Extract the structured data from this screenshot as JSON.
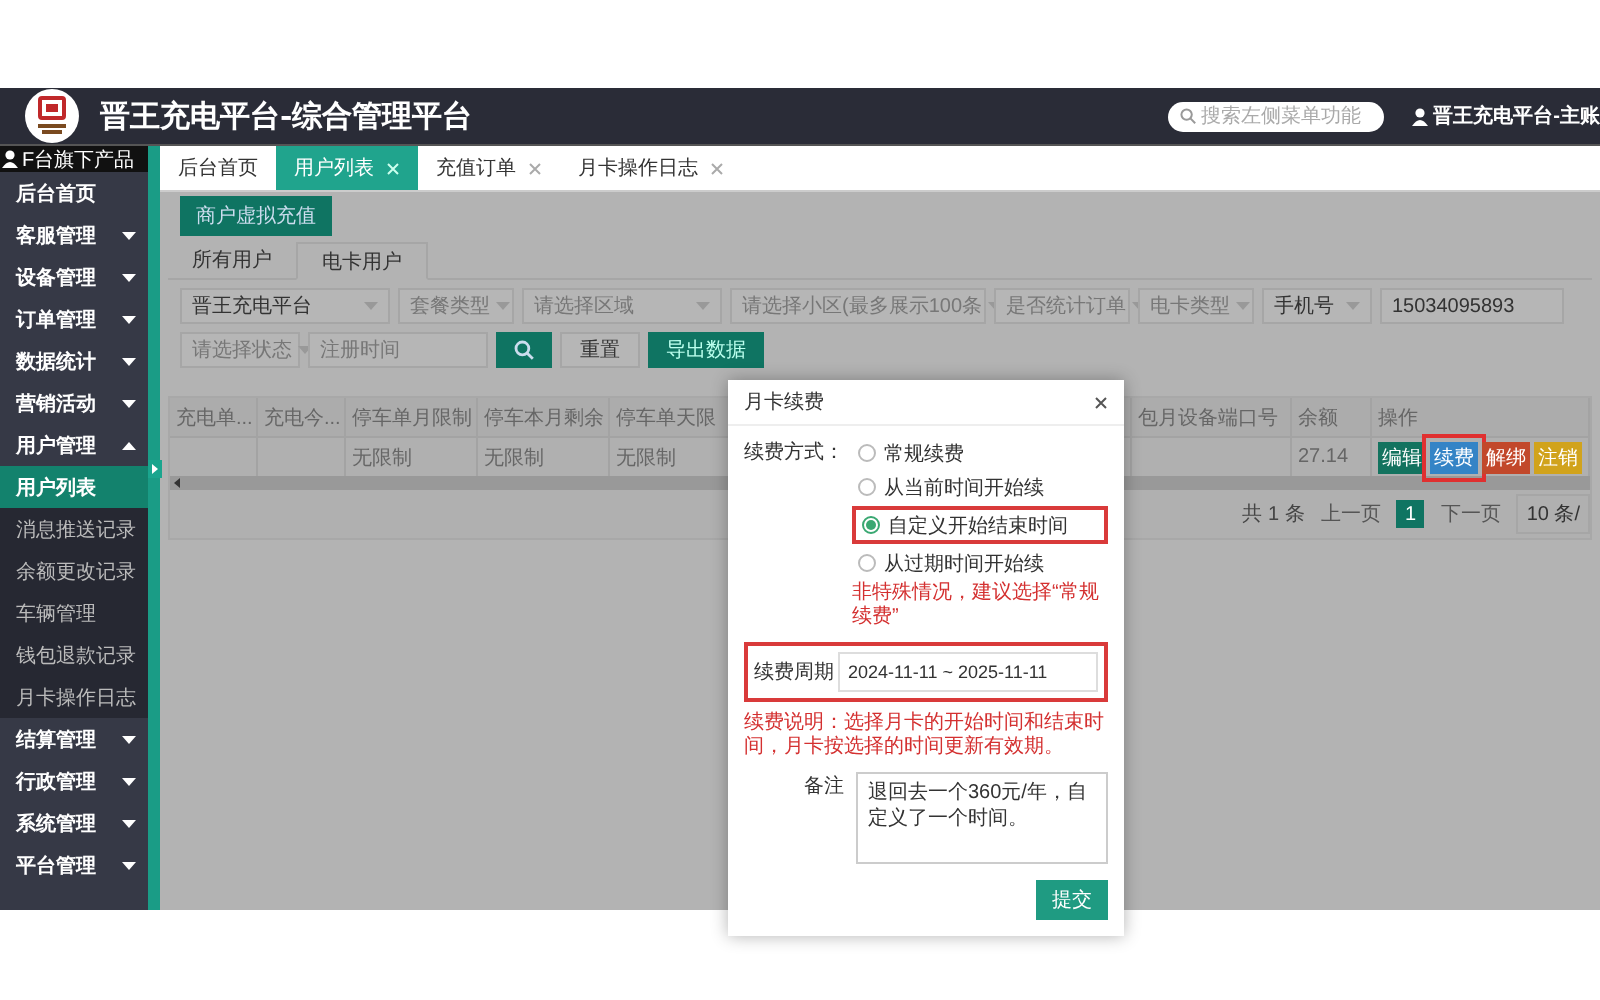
{
  "header": {
    "title": "晋王充电平台-综合管理平台",
    "search": {
      "placeholder": "搜索左侧菜单功能"
    },
    "user": "晋王充电平台-主账"
  },
  "sidebar": {
    "account": "F台旗下产品",
    "items": [
      {
        "label": "后台首页",
        "kind": "link"
      },
      {
        "label": "客服管理",
        "kind": "group",
        "expanded": false
      },
      {
        "label": "设备管理",
        "kind": "group",
        "expanded": false
      },
      {
        "label": "订单管理",
        "kind": "group",
        "expanded": false
      },
      {
        "label": "数据统计",
        "kind": "group",
        "expanded": false
      },
      {
        "label": "营销活动",
        "kind": "group",
        "expanded": false
      },
      {
        "label": "用户管理",
        "kind": "group",
        "expanded": true,
        "children": [
          {
            "label": "用户列表",
            "selected": true
          },
          {
            "label": "消息推送记录",
            "selected": false
          },
          {
            "label": "余额更改记录",
            "selected": false
          },
          {
            "label": "车辆管理",
            "selected": false
          },
          {
            "label": "钱包退款记录",
            "selected": false
          },
          {
            "label": "月卡操作日志",
            "selected": false
          }
        ]
      },
      {
        "label": "结算管理",
        "kind": "group",
        "expanded": false
      },
      {
        "label": "行政管理",
        "kind": "group",
        "expanded": false
      },
      {
        "label": "系统管理",
        "kind": "group",
        "expanded": false
      },
      {
        "label": "平台管理",
        "kind": "group",
        "expanded": false
      }
    ]
  },
  "tabs": [
    {
      "label": "后台首页",
      "selected": false,
      "closable": false
    },
    {
      "label": "用户列表",
      "selected": true,
      "closable": true
    },
    {
      "label": "充值订单",
      "selected": false,
      "closable": true
    },
    {
      "label": "月卡操作日志",
      "selected": false,
      "closable": true
    }
  ],
  "action_button": "商户虚拟充值",
  "user_tabs": [
    {
      "label": "所有用户",
      "selected": false
    },
    {
      "label": "电卡用户",
      "selected": true
    }
  ],
  "filters": [
    {
      "kind": "select",
      "value": "晋王充电平台"
    },
    {
      "kind": "select",
      "placeholder": "套餐类型"
    },
    {
      "kind": "select",
      "placeholder": "请选择区域"
    },
    {
      "kind": "select",
      "placeholder": "请选择小区(最多展示100条"
    },
    {
      "kind": "select",
      "placeholder": "是否统计订单"
    },
    {
      "kind": "select",
      "placeholder": "电卡类型"
    },
    {
      "kind": "select",
      "value": "手机号"
    },
    {
      "kind": "input",
      "value": "15034095893"
    }
  ],
  "filters_2": [
    {
      "kind": "select",
      "placeholder": "请选择状态"
    },
    {
      "kind": "input",
      "placeholder": "注册时间"
    }
  ],
  "buttons": [
    {
      "kind": "search"
    },
    {
      "kind": "plain",
      "label": "重置"
    },
    {
      "kind": "primary",
      "label": "导出数据"
    }
  ],
  "table": {
    "columns": [
      "充电单...",
      "充电今...",
      "停车单月限制",
      "停车本月剩余",
      "停车单天限",
      "包月设备端口号",
      "余额",
      "操作"
    ],
    "rows": [
      {
        "cells": [
          "",
          "",
          "无限制",
          "无限制",
          "无限制",
          "",
          "27.14"
        ],
        "actions": [
          {
            "label": "编辑",
            "color": "#13735f",
            "highlighted": false
          },
          {
            "label": "续费",
            "color": "#3484c6",
            "highlighted": true
          },
          {
            "label": "解绑",
            "color": "#c2482b",
            "highlighted": false
          },
          {
            "label": "注销",
            "color": "#d1a31c",
            "highlighted": false
          }
        ]
      }
    ]
  },
  "pagination": {
    "summary": "共 1 条",
    "prev": "上一页",
    "pages": [
      {
        "label": "1",
        "selected": true
      }
    ],
    "next": "下一页",
    "page_size": "10 条/"
  },
  "dialog": {
    "title": "月卡续费",
    "method_label": "续费方式：",
    "options": [
      {
        "label": "常规续费",
        "selected": false,
        "highlighted": false
      },
      {
        "label": "从当前时间开始续",
        "selected": false,
        "highlighted": false
      },
      {
        "label": "自定义开始结束时间",
        "selected": true,
        "highlighted": true
      },
      {
        "label": "从过期时间开始续",
        "selected": false,
        "highlighted": false
      }
    ],
    "warning": "非特殊情况，建议选择“常规续费”",
    "period": {
      "label": "续费周期",
      "value": "2024-11-11 ~ 2025-11-11",
      "highlighted": true
    },
    "note": "续费说明：选择月卡的开始时间和结束时间，月卡按选择的时间更新有效期。",
    "remark": {
      "label": "备注",
      "value": "退回去一个360元/年，自定义了一个时间。"
    },
    "submit": "提交"
  }
}
